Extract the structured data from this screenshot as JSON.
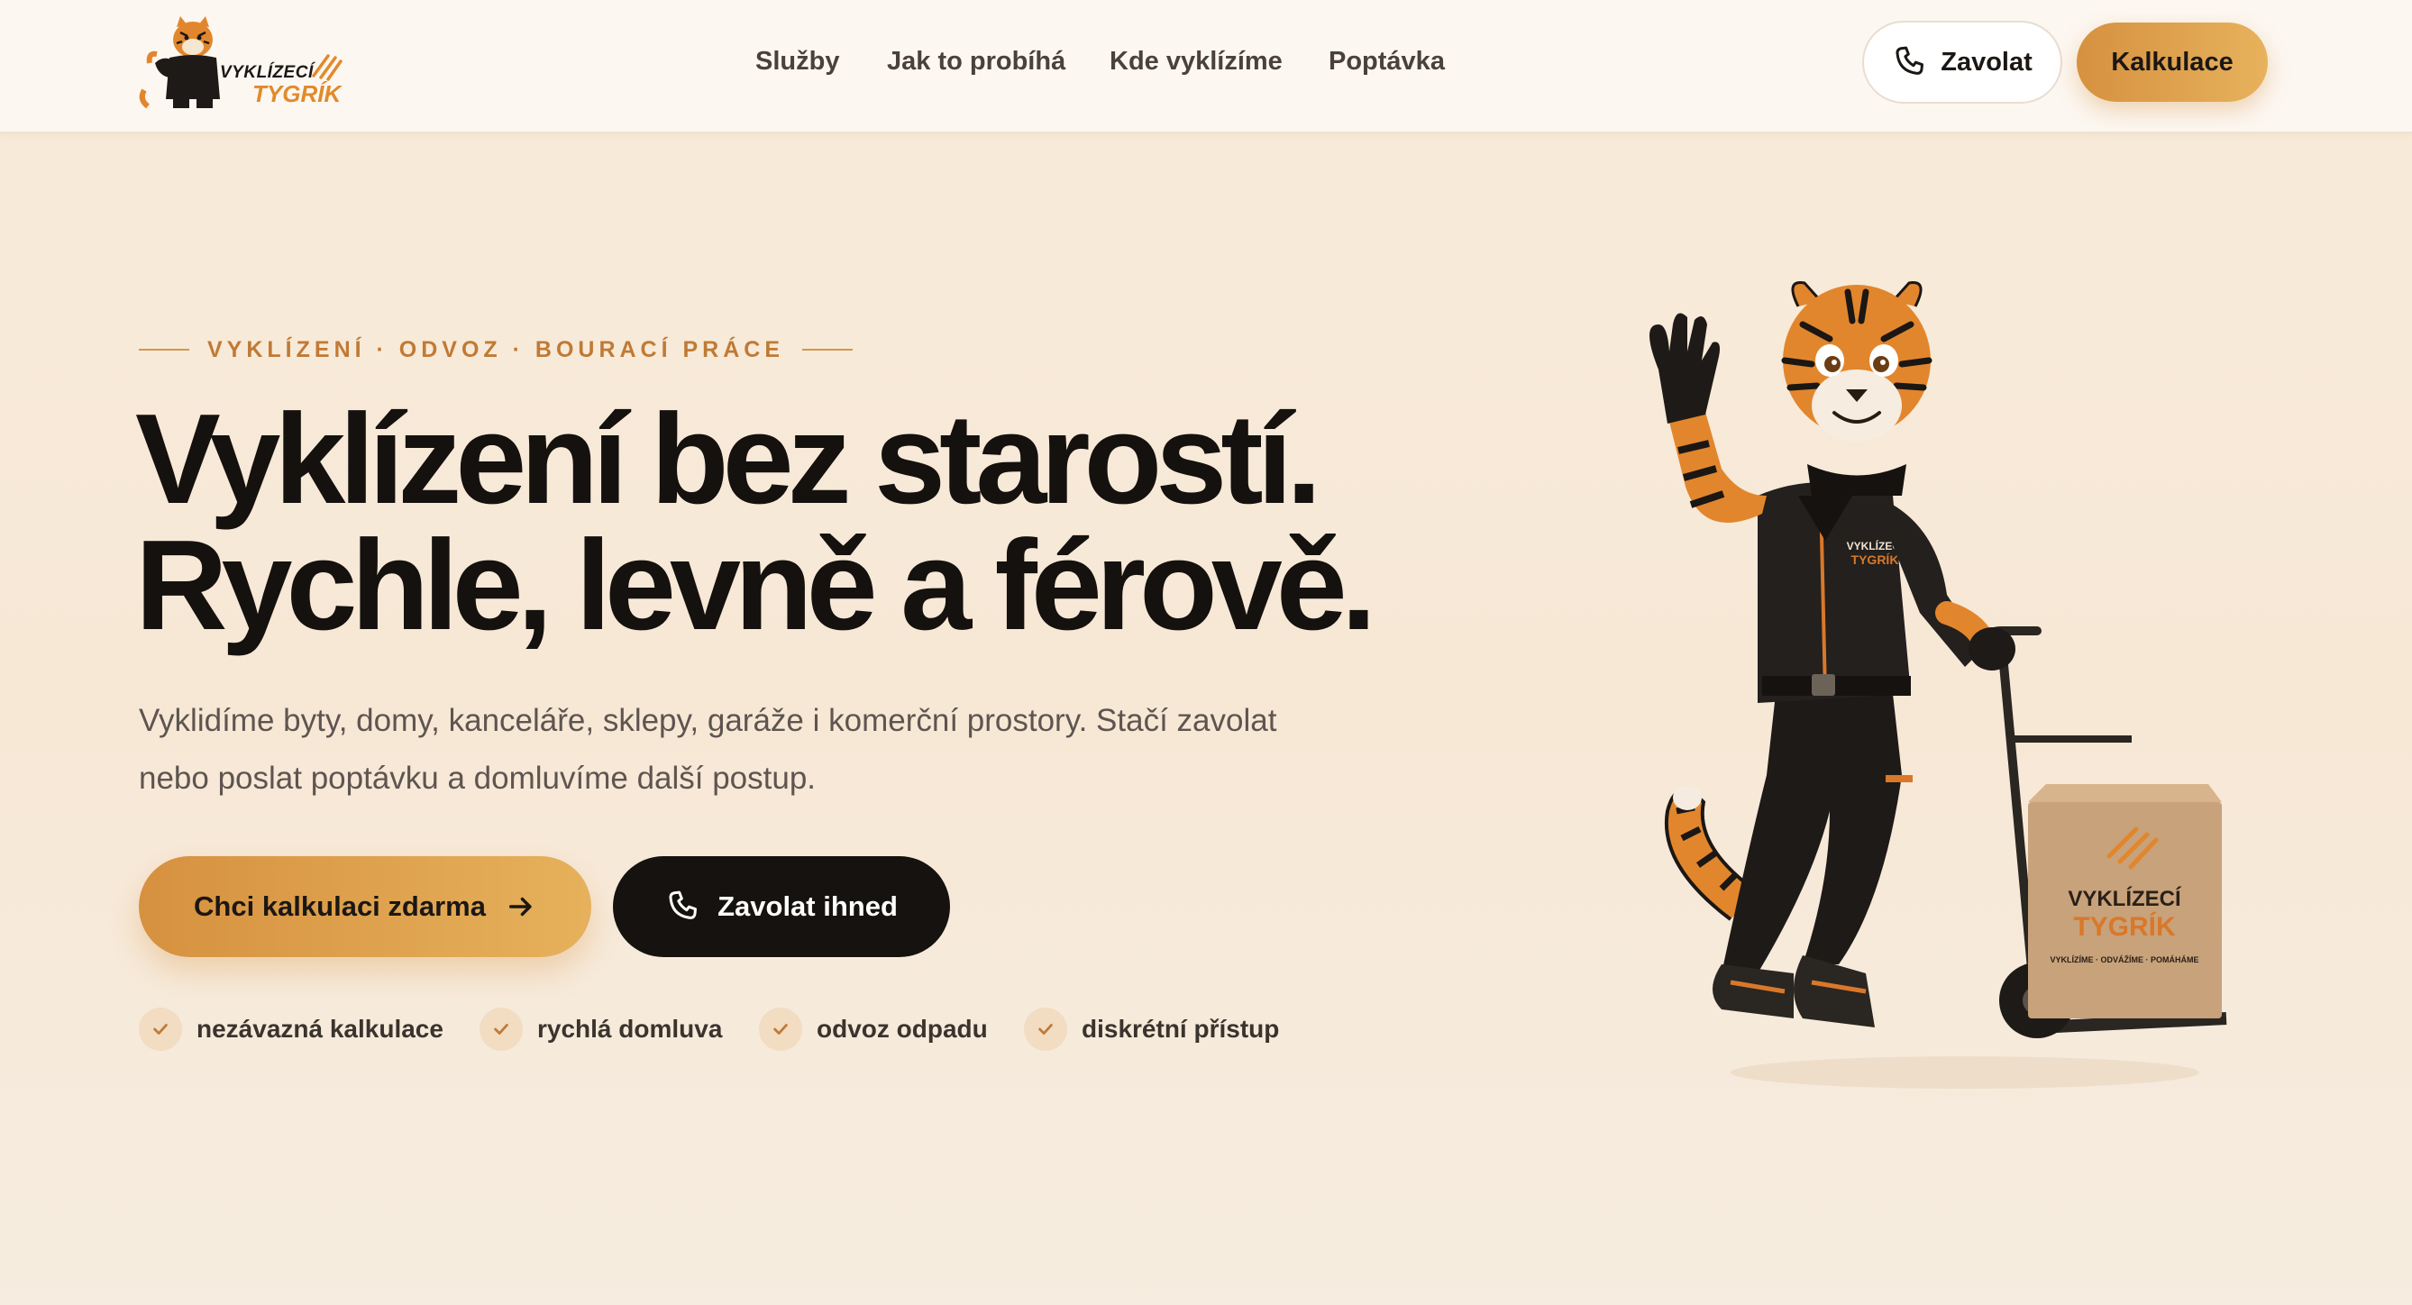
{
  "header": {
    "logo": {
      "line1": "VYKLÍZECÍ",
      "line2": "TYGRÍK"
    },
    "nav": [
      {
        "label": "Služby"
      },
      {
        "label": "Jak to probíhá"
      },
      {
        "label": "Kde vyklízíme"
      },
      {
        "label": "Poptávka"
      }
    ],
    "call_button": {
      "label": "Zavolat",
      "icon": "phone-icon"
    },
    "calc_button": {
      "label": "Kalkulace"
    }
  },
  "hero": {
    "eyebrow": "VYKLÍZENÍ · ODVOZ · BOURACÍ PRÁCE",
    "headline_line1": "Vyklízení bez starostí.",
    "headline_line2": "Rychle, levně a férově.",
    "subtext_line1": "Vyklidíme byty, domy, kanceláře, sklepy, garáže i komerční prostory. Stačí zavolat",
    "subtext_line2": "nebo poslat poptávku a domluvíme další postup.",
    "primary_button": {
      "label": "Chci kalkulaci zdarma",
      "icon": "arrow-right-icon"
    },
    "secondary_button": {
      "label": "Zavolat ihned",
      "icon": "phone-icon"
    },
    "checks": [
      {
        "label": "nezávazná kalkulace"
      },
      {
        "label": "rychlá domluva"
      },
      {
        "label": "odvoz odpadu"
      },
      {
        "label": "diskrétní přístup"
      }
    ]
  },
  "mascot": {
    "shirt_text_1": "VYKLÍZECÍ",
    "shirt_text_2": "TYGRÍK",
    "box_text_1": "VYKLÍZECÍ",
    "box_text_2": "TYGRÍK",
    "box_tagline": "VYKLÍZÍME · ODVÁŽÍME · POMÁHÁME"
  },
  "colors": {
    "accent": "#d6913f",
    "accent_light": "#e7b25d",
    "dark": "#15120f",
    "eyebrow": "#c07a35",
    "background": "#f8ebda"
  }
}
